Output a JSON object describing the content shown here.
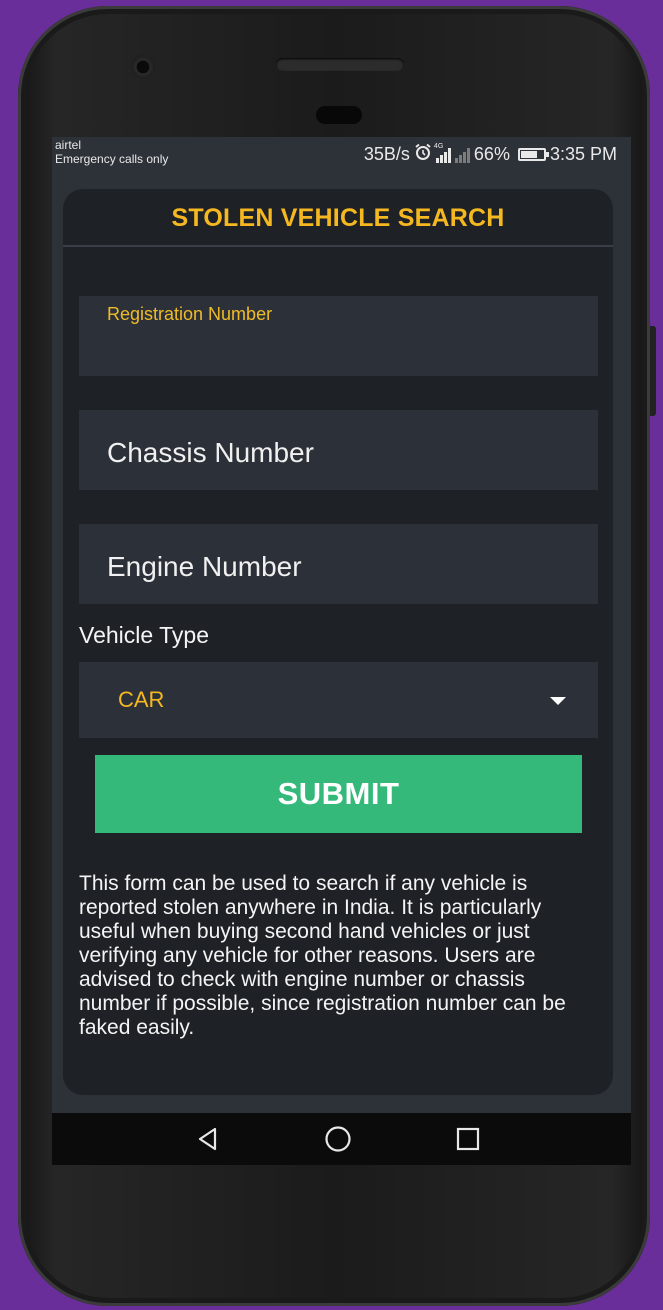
{
  "status_bar": {
    "carrier": "airtel",
    "carrier_sub": "Emergency calls only",
    "speed": "35B/s",
    "network_tag": "4G",
    "battery_percent": "66%",
    "time": "3:35 PM",
    "icons": [
      "alarm-icon",
      "signal-icon",
      "signal-no-sim-icon",
      "battery-icon"
    ]
  },
  "header": {
    "title": "STOLEN VEHICLE SEARCH"
  },
  "form": {
    "registration": {
      "label": "Registration Number",
      "value": ""
    },
    "chassis": {
      "placeholder": "Chassis Number"
    },
    "engine": {
      "placeholder": "Engine Number"
    },
    "vehicle_type": {
      "label": "Vehicle Type",
      "selected": "CAR"
    },
    "submit_label": "SUBMIT"
  },
  "description": "This form can be used to search if any vehicle is reported stolen anywhere in India. It is particularly useful when buying second hand vehicles or just verifying any vehicle for other reasons. Users are advised to check with engine number or chassis number if possible, since registration number can be faked easily.",
  "nav_bar": {
    "icons": [
      "back-icon",
      "home-icon",
      "recents-icon"
    ]
  },
  "colors": {
    "accent": "#f5b820",
    "submit": "#34b97a",
    "card": "#1e2126",
    "field": "#2c3039",
    "frame": "#6a2e9b"
  }
}
